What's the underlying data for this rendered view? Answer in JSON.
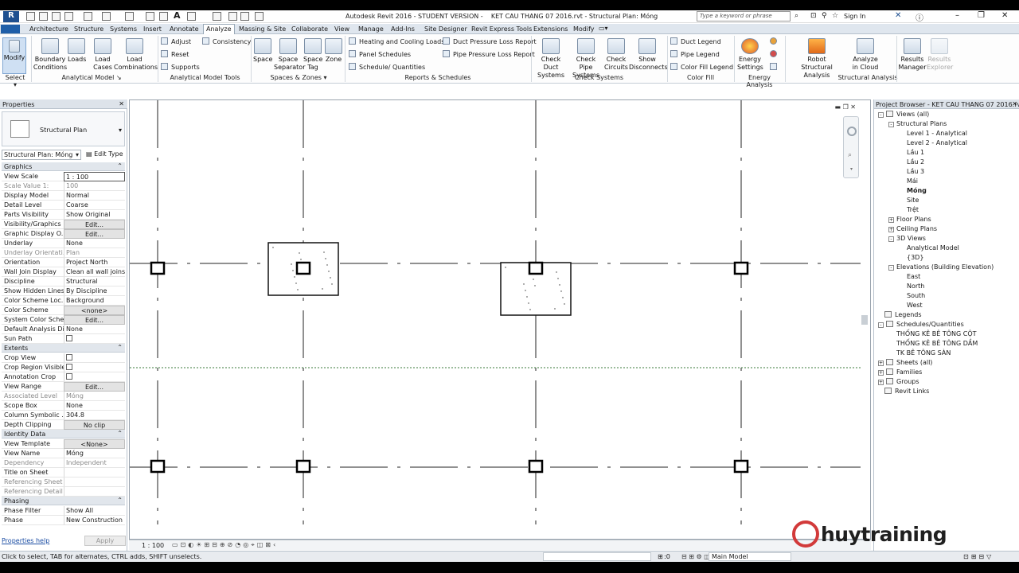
{
  "app": {
    "title": "Autodesk Revit 2016 - STUDENT VERSION -    KET CAU THANG 07 2016.rvt - Structural Plan: Móng",
    "search_placeholder": "Type a keyword or phrase",
    "sign_in": "Sign In"
  },
  "tabs": [
    "Architecture",
    "Structure",
    "Systems",
    "Insert",
    "Annotate",
    "Analyze",
    "Massing & Site",
    "Collaborate",
    "View",
    "Manage",
    "Add-Ins",
    "Site Designer",
    "Revit Express Tools",
    "Extensions",
    "Modify"
  ],
  "active_tab": "Analyze",
  "ribbon": {
    "modify": "Modify",
    "select": "Select",
    "boundary_conditions": [
      "Boundary",
      "Conditions"
    ],
    "loads": "Loads",
    "load_cases": [
      "Load",
      "Cases"
    ],
    "load_combinations": [
      "Load",
      "Combinations"
    ],
    "analytical_model": "Analytical Model",
    "adjust": "Adjust",
    "reset": "Reset",
    "supports": "Supports",
    "consistency": "Consistency",
    "analytical_model_tools": "Analytical Model Tools",
    "space": "Space",
    "space_separator": [
      "Space",
      "Separator"
    ],
    "space_tag": [
      "Space",
      "Tag"
    ],
    "zone": "Zone",
    "spaces_zones": "Spaces & Zones",
    "heating_cooling": "Heating and  Cooling Loads",
    "panel_schedules": "Panel  Schedules",
    "schedule_quantities": "Schedule/  Quantities",
    "duct_pressure": "Duct Pressure  Loss Report",
    "pipe_pressure": "Pipe Pressure  Loss Report",
    "reports_schedules": "Reports & Schedules",
    "check_duct": [
      "Check Duct",
      "Systems"
    ],
    "check_pipe": [
      "Check Pipe",
      "Systems"
    ],
    "check_circuits": [
      "Check",
      "Circuits"
    ],
    "show_disconnects": [
      "Show",
      "Disconnects"
    ],
    "check_systems": "Check Systems",
    "duct_legend": "Duct  Legend",
    "pipe_legend": "Pipe  Legend",
    "color_fill_legend": "Color Fill  Legend",
    "color_fill": "Color Fill",
    "energy_settings": [
      "Energy",
      "Settings"
    ],
    "energy_analysis": "Energy Analysis",
    "robot": [
      "Robot",
      "Structural Analysis"
    ],
    "analyze_cloud": [
      "Analyze",
      "in Cloud"
    ],
    "structural_analysis": "Structural Analysis",
    "results_manager": [
      "Results",
      "Manager"
    ],
    "results_explorer": [
      "Results",
      "Explorer"
    ]
  },
  "properties": {
    "title": "Properties",
    "type_name": "Structural Plan",
    "selector": "Structural Plan: Móng",
    "edit_type": "Edit Type",
    "help": "Properties help",
    "apply": "Apply",
    "sections": [
      {
        "name": "Graphics",
        "rows": [
          [
            "View Scale",
            "1 : 100",
            ""
          ],
          [
            "Scale Value   1:",
            "100",
            "grey"
          ],
          [
            "Display Model",
            "Normal",
            ""
          ],
          [
            "Detail Level",
            "Coarse",
            ""
          ],
          [
            "Parts Visibility",
            "Show Original",
            ""
          ],
          [
            "Visibility/Graphics ...",
            "Edit...",
            "btn"
          ],
          [
            "Graphic Display O...",
            "Edit...",
            "btn"
          ],
          [
            "Underlay",
            "None",
            ""
          ],
          [
            "Underlay Orientati...",
            "Plan",
            "grey"
          ],
          [
            "Orientation",
            "Project North",
            ""
          ],
          [
            "Wall Join Display",
            "Clean all wall joins",
            ""
          ],
          [
            "Discipline",
            "Structural",
            ""
          ],
          [
            "Show Hidden Lines",
            "By Discipline",
            ""
          ],
          [
            "Color Scheme Loc...",
            "Background",
            ""
          ],
          [
            "Color Scheme",
            "<none>",
            "btn"
          ],
          [
            "System Color Sche...",
            "Edit...",
            "btn"
          ],
          [
            "Default Analysis Di...",
            "None",
            ""
          ],
          [
            "Sun Path",
            "[ ]",
            "chk"
          ]
        ]
      },
      {
        "name": "Extents",
        "rows": [
          [
            "Crop View",
            "[ ]",
            "chk"
          ],
          [
            "Crop Region Visible",
            "[ ]",
            "chk"
          ],
          [
            "Annotation Crop",
            "[ ]",
            "chk"
          ],
          [
            "View Range",
            "Edit...",
            "btn"
          ],
          [
            "Associated Level",
            "Móng",
            "grey"
          ],
          [
            "Scope Box",
            "None",
            ""
          ],
          [
            "Column Symbolic ...",
            "304.8",
            ""
          ],
          [
            "Depth Clipping",
            "No clip",
            "btn"
          ]
        ]
      },
      {
        "name": "Identity Data",
        "rows": [
          [
            "View Template",
            "<None>",
            "btn"
          ],
          [
            "View Name",
            "Móng",
            ""
          ],
          [
            "Dependency",
            "Independent",
            "grey"
          ],
          [
            "Title on Sheet",
            "",
            ""
          ],
          [
            "Referencing Sheet",
            "",
            "grey"
          ],
          [
            "Referencing Detail",
            "",
            "grey"
          ]
        ]
      },
      {
        "name": "Phasing",
        "rows": [
          [
            "Phase Filter",
            "Show All",
            ""
          ],
          [
            "Phase",
            "New Construction",
            ""
          ]
        ]
      }
    ]
  },
  "browser": {
    "title": "Project Browser - KET CAU THANG 07 2016.rvt",
    "tree": [
      {
        "t": "Views (all)",
        "l": 0,
        "e": "-"
      },
      {
        "t": "Structural Plans",
        "l": 1,
        "e": "-"
      },
      {
        "t": "Level 1 - Analytical",
        "l": 2,
        "e": ""
      },
      {
        "t": "Level 2 - Analytical",
        "l": 2,
        "e": ""
      },
      {
        "t": "Lầu 1",
        "l": 2,
        "e": ""
      },
      {
        "t": "Lầu 2",
        "l": 2,
        "e": ""
      },
      {
        "t": "Lầu 3",
        "l": 2,
        "e": ""
      },
      {
        "t": "Mái",
        "l": 2,
        "e": ""
      },
      {
        "t": "Móng",
        "l": 2,
        "e": "",
        "bold": true
      },
      {
        "t": "Site",
        "l": 2,
        "e": ""
      },
      {
        "t": "Trệt",
        "l": 2,
        "e": ""
      },
      {
        "t": "Floor Plans",
        "l": 1,
        "e": "+"
      },
      {
        "t": "Ceiling Plans",
        "l": 1,
        "e": "+"
      },
      {
        "t": "3D Views",
        "l": 1,
        "e": "-"
      },
      {
        "t": "Analytical Model",
        "l": 2,
        "e": ""
      },
      {
        "t": "{3D}",
        "l": 2,
        "e": ""
      },
      {
        "t": "Elevations (Building Elevation)",
        "l": 1,
        "e": "-"
      },
      {
        "t": "East",
        "l": 2,
        "e": ""
      },
      {
        "t": "North",
        "l": 2,
        "e": ""
      },
      {
        "t": "South",
        "l": 2,
        "e": ""
      },
      {
        "t": "West",
        "l": 2,
        "e": ""
      },
      {
        "t": "Legends",
        "l": 0,
        "e": ""
      },
      {
        "t": "Schedules/Quantities",
        "l": 0,
        "e": "-"
      },
      {
        "t": "THỐNG KÊ BÊ TÔNG CỘT",
        "l": 1,
        "e": ""
      },
      {
        "t": "THỐNG KÊ BÊ TÔNG DẦM",
        "l": 1,
        "e": ""
      },
      {
        "t": "TK BÊ TÔNG SÀN",
        "l": 1,
        "e": ""
      },
      {
        "t": "Sheets (all)",
        "l": 0,
        "e": "+"
      },
      {
        "t": "Families",
        "l": 0,
        "e": "+"
      },
      {
        "t": "Groups",
        "l": 0,
        "e": "+"
      },
      {
        "t": "Revit Links",
        "l": 0,
        "e": ""
      }
    ]
  },
  "viewbar": {
    "scale": "1 : 100"
  },
  "status": {
    "hint": "Click to select, TAB for alternates, CTRL adds, SHIFT unselects.",
    "coord": ":0",
    "model": "Main Model"
  },
  "watermark": {
    "brand": "huytraining",
    ".com": ".com"
  }
}
